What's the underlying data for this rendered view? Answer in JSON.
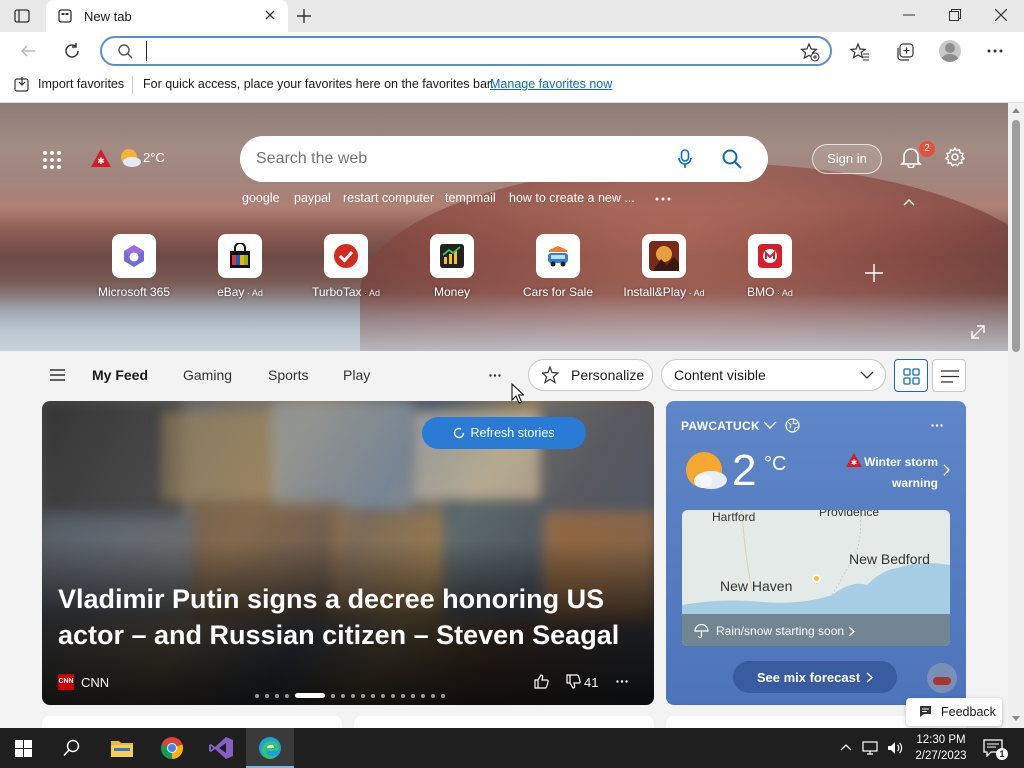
{
  "tab": {
    "title": "New tab"
  },
  "address": {
    "value": "",
    "placeholder": ""
  },
  "favbar": {
    "import": "Import favorites",
    "hint": "For quick access, place your favorites here on the favorites bar.",
    "manage": "Manage favorites now"
  },
  "hero": {
    "temp": "2°C",
    "search_placeholder": "Search the web",
    "trending": [
      "google",
      "paypal",
      "restart computer",
      "tempmail",
      "how to create a new ..."
    ],
    "signin": "Sign in",
    "notif_count": "2",
    "tiles": [
      {
        "label": "Microsoft 365",
        "ad": ""
      },
      {
        "label": "eBay",
        "ad": " · Ad"
      },
      {
        "label": "TurboTax",
        "ad": " · Ad"
      },
      {
        "label": "Money",
        "ad": ""
      },
      {
        "label": "Cars for Sale",
        "ad": ""
      },
      {
        "label": "Install&Play",
        "ad": " · Ad"
      },
      {
        "label": "BMO",
        "ad": " · Ad"
      }
    ]
  },
  "feed": {
    "tabs": [
      "My Feed",
      "Gaming",
      "Sports",
      "Play"
    ],
    "personalize": "Personalize",
    "content": "Content visible",
    "refresh": "Refresh stories",
    "headline": "Vladimir Putin signs a decree honoring US actor – and Russian citizen – Steven Seagal",
    "source": "CNN",
    "source_badge": "CNN",
    "dislikes": "41"
  },
  "weather": {
    "location": "PAWCATUCK",
    "temp": "2",
    "unit": "°C",
    "alert": "Winter storm warning",
    "cities": [
      "Hartford",
      "Providence",
      "New Bedford",
      "New Haven"
    ],
    "condition": "Rain/snow starting soon",
    "cta": "See mix forecast"
  },
  "feedback": "Feedback",
  "taskbar": {
    "time": "12:30 PM",
    "date": "2/27/2023",
    "notif": "1"
  },
  "colors": {
    "accent": "#0f6cbd",
    "refresh": "#2a7bd6",
    "weather_card": "#5479c0"
  }
}
